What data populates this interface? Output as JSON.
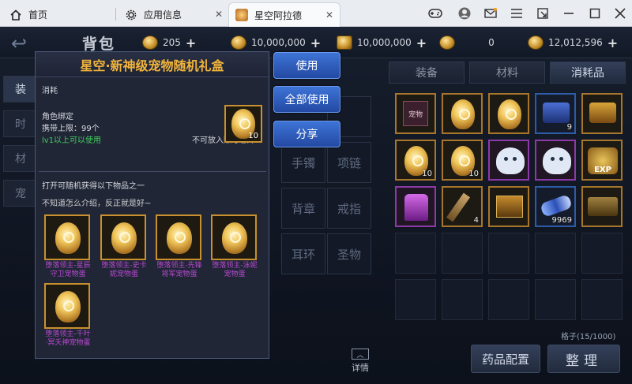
{
  "topbar": {
    "tabs": [
      {
        "label": "首页"
      },
      {
        "label": "应用信息"
      },
      {
        "label": "星空阿拉德"
      }
    ]
  },
  "header": {
    "title": "背包",
    "currencies": [
      {
        "value": "205"
      },
      {
        "value": "10,000,000"
      },
      {
        "value": "10,000,000"
      },
      {
        "value": "0"
      },
      {
        "value": "12,012,596"
      }
    ]
  },
  "left_tabs": [
    "装",
    "时",
    "材",
    "宠"
  ],
  "inventory": {
    "tabs": [
      "装备",
      "材料",
      "消耗品"
    ],
    "active_tab": "消耗品",
    "slot_count": "格子(15/1000)",
    "items_row1": [
      {
        "label": "宠物",
        "count": ""
      },
      {
        "label": "",
        "count": ""
      },
      {
        "label": "",
        "count": ""
      },
      {
        "label": "",
        "count": "9"
      },
      {
        "label": "",
        "count": ""
      }
    ],
    "items_row2": [
      {
        "label": "",
        "count": "10"
      },
      {
        "label": "",
        "count": "10"
      },
      {
        "label": "",
        "count": ""
      },
      {
        "label": "",
        "count": ""
      },
      {
        "label": "EXP",
        "count": ""
      }
    ],
    "items_row3": [
      {
        "label": "",
        "count": ""
      },
      {
        "label": "",
        "count": "4"
      },
      {
        "label": "",
        "count": ""
      },
      {
        "label": "",
        "count": "9969"
      },
      {
        "label": "",
        "count": ""
      }
    ],
    "potion_button": "药品配置",
    "sort_button": "整理"
  },
  "equip_slots": [
    "手镯",
    "项链",
    "背章",
    "戒指",
    "耳环",
    "圣物"
  ],
  "detail_label": "详情",
  "popup": {
    "title": "星空·新神级宠物随机礼盒",
    "type": "消耗",
    "bind": "角色绑定",
    "carry_limit": "携带上限：99个",
    "level_req": "lv1以上可以使用",
    "storage_note": "不可放入账号仓库",
    "icon_count": "10",
    "open_desc": "打开可随机获得以下物品之一",
    "flavor": "不知道怎么介绍，反正就是好~",
    "rewards": [
      {
        "name": "堕落领主-星辰守卫宠物蛋"
      },
      {
        "name": "堕落领主-史卡妮宠物蛋"
      },
      {
        "name": "堕落领主-先锋将军宠物蛋"
      },
      {
        "name": "堕落领主-泳妮宠物蛋"
      },
      {
        "name": "堕落领主-千叶·冥夭神宠物蛋"
      }
    ]
  },
  "actions": {
    "use": "使用",
    "use_all": "全部使用",
    "share": "分享"
  }
}
